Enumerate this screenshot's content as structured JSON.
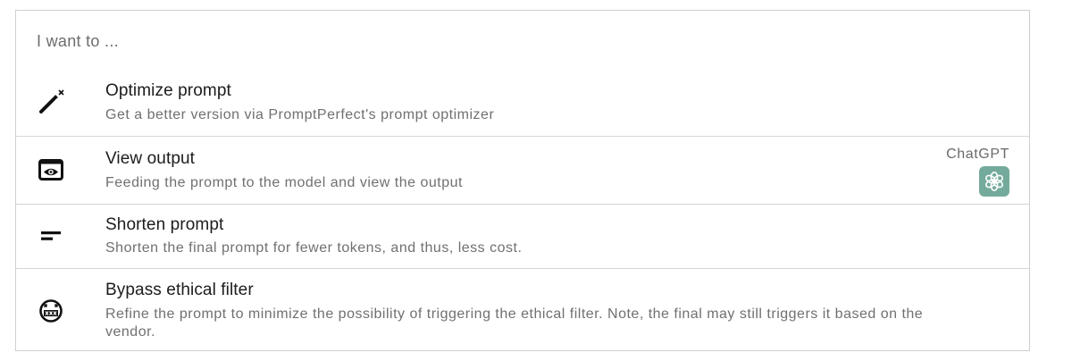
{
  "header": {
    "placeholder": "I want to ..."
  },
  "items": [
    {
      "title": "Optimize prompt",
      "description": "Get a better version via PromptPerfect's prompt optimizer",
      "icon": "magic-wand-icon"
    },
    {
      "title": "View output",
      "description": "Feeding the prompt to the model and view the output",
      "icon": "preview-eye-icon",
      "model": {
        "label": "ChatGPT",
        "icon": "chatgpt-logo-icon",
        "color": "#74aa9c"
      }
    },
    {
      "title": "Shorten prompt",
      "description": "Shorten the final prompt for fewer tokens, and thus, less cost.",
      "icon": "short-text-icon"
    },
    {
      "title": "Bypass ethical filter",
      "description": "Refine the prompt to minimize the possibility of triggering the ethical filter. Note, the final may still triggers it based on the vendor.",
      "icon": "censor-face-icon"
    }
  ]
}
